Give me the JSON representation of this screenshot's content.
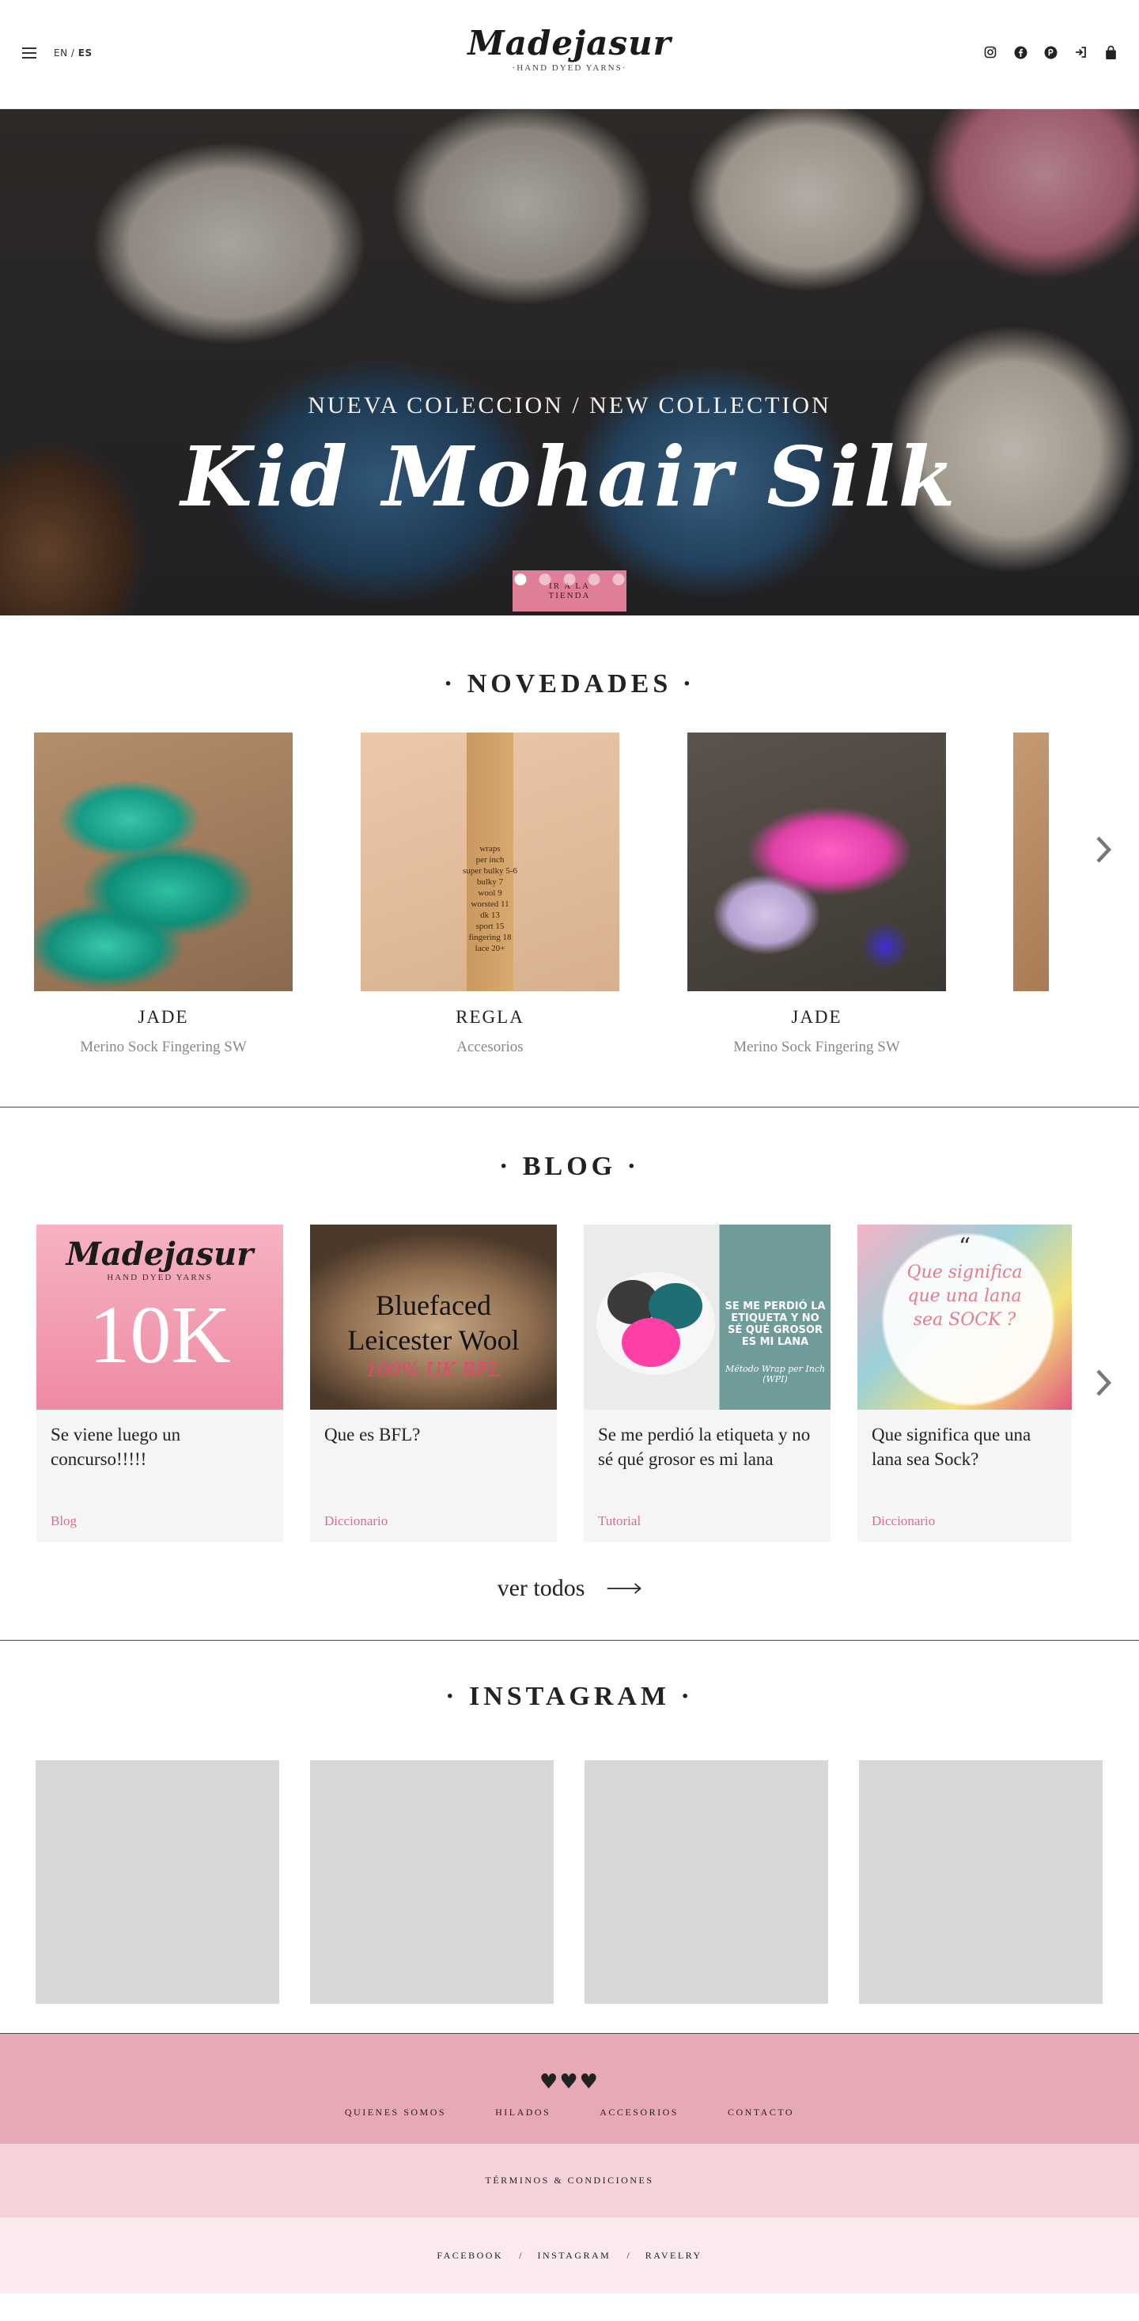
{
  "header": {
    "lang_en": "EN",
    "lang_sep": "/",
    "lang_es": "ES",
    "logo_name": "Madejasur",
    "logo_sub": "·HAND DYED YARNS·",
    "icons": [
      "instagram-icon",
      "facebook-icon",
      "ravelry-icon",
      "login-icon",
      "cart-icon"
    ]
  },
  "hero": {
    "kicker": "NUEVA COLECCION / NEW COLLECTION",
    "title": "Kid Mohair Silk",
    "button": "IR A LA TIENDA",
    "slides": 5,
    "active_slide": 1
  },
  "novedades": {
    "title": "· NOVEDADES ·",
    "products": [
      {
        "name": "JADE",
        "category": "Merino Sock Fingering SW"
      },
      {
        "name": "REGLA",
        "category": "Accesorios"
      },
      {
        "name": "JADE",
        "category": "Merino Sock Fingering SW"
      }
    ],
    "ruler_text": "wraps\nper inch\nsuper bulky 5-6\nbulky 7\nwool 9\nworsted 11\ndk 13\nsport 15\nfingering 18\nlace 20+"
  },
  "blog": {
    "title": "· BLOG ·",
    "posts": [
      {
        "title": "Se viene luego un concurso!!!!!",
        "category": "Blog"
      },
      {
        "title": "Que es BFL?",
        "category": "Diccionario"
      },
      {
        "title": "Se me perdió la etiqueta y no sé qué grosor es mi lana",
        "category": "Tutorial"
      },
      {
        "title": "Que significa que una lana sea Sock?",
        "category": "Diccionario"
      }
    ],
    "post1_img": {
      "logo": "Madejasur",
      "sub": "HAND DYED YARNS",
      "big": "10K"
    },
    "post2_img": {
      "line1": "Bluefaced",
      "line2": "Leicester Wool",
      "line3": "100% UK BFL"
    },
    "post3_img": {
      "text": "SE ME PERDIÓ LA ETIQUETA Y NO SÉ QUÉ GROSOR ES MI LANA",
      "sub": "Método Wrap per Inch (WPI)"
    },
    "post4_img": {
      "quote": "“",
      "text": "Que significa que una lana sea SOCK ?"
    },
    "view_all": "ver todos"
  },
  "instagram": {
    "title": "· INSTAGRAM ·",
    "items": 4
  },
  "footer": {
    "logo": "♥♥♥",
    "nav": [
      "QUIENES SOMOS",
      "HILADOS",
      "ACCESORIOS",
      "CONTACTO"
    ],
    "terms": "TÉRMINOS & CONDICIONES",
    "social": [
      "FACEBOOK",
      "INSTAGRAM",
      "RAVELRY"
    ],
    "social_sep": "/"
  },
  "colors": {
    "accent_pink": "#de7f97",
    "footer_top": "#e6a9b5",
    "footer_mid": "#f5d2d9",
    "footer_bottom": "#faeaee",
    "category_pink": "#d9708a"
  }
}
